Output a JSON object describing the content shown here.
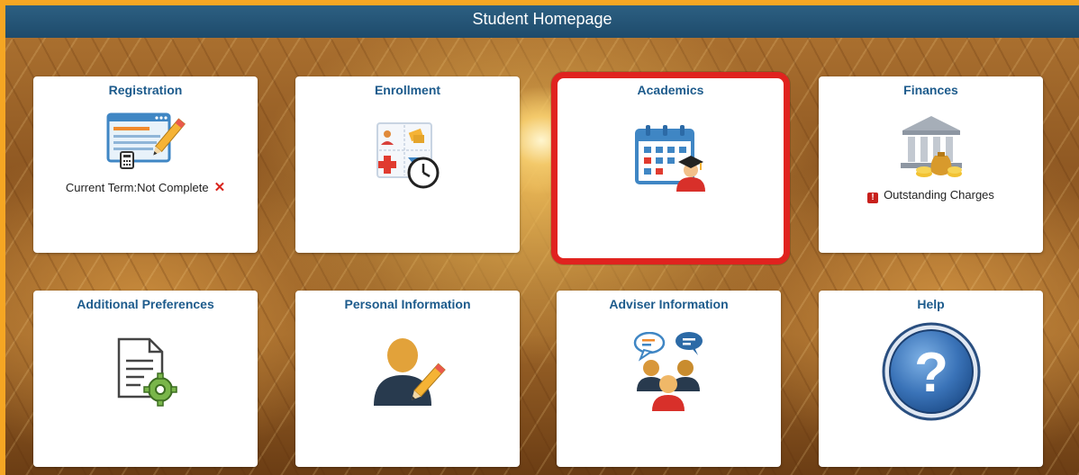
{
  "header": {
    "title": "Student Homepage"
  },
  "tiles": [
    {
      "title": "Registration",
      "icon": "registration-form-icon",
      "status": "Current Term:Not Complete",
      "status_icon": "x-mark-icon"
    },
    {
      "title": "Enrollment",
      "icon": "enrollment-schedule-icon"
    },
    {
      "title": "Academics",
      "icon": "academics-calendar-graduate-icon",
      "selected": true
    },
    {
      "title": "Finances",
      "icon": "bank-money-icon",
      "status": "Outstanding Charges",
      "status_icon": "alert-icon",
      "alert_symbol": "!"
    },
    {
      "title": "Additional Preferences",
      "icon": "document-settings-icon"
    },
    {
      "title": "Personal Information",
      "icon": "person-edit-icon"
    },
    {
      "title": "Adviser Information",
      "icon": "adviser-chat-icon"
    },
    {
      "title": "Help",
      "icon": "help-question-icon",
      "help_symbol": "?"
    }
  ],
  "colors": {
    "header_bg": "#1e4b6b",
    "tile_title": "#1d5b8c",
    "selected_border": "#e0231f",
    "page_border": "#f5a623"
  }
}
